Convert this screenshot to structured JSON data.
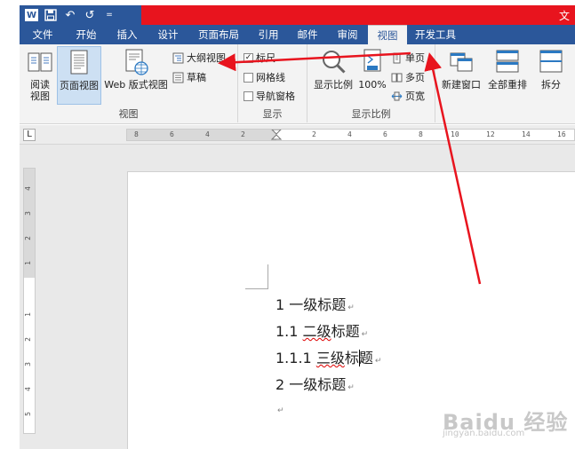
{
  "window": {
    "title_fragment": "文"
  },
  "qat": {
    "undo": "↶",
    "redo": "↺",
    "more": "="
  },
  "tabs": [
    {
      "label": "文件"
    },
    {
      "label": "开始"
    },
    {
      "label": "插入"
    },
    {
      "label": "设计"
    },
    {
      "label": "页面布局"
    },
    {
      "label": "引用"
    },
    {
      "label": "邮件"
    },
    {
      "label": "审阅"
    },
    {
      "label": "视图",
      "active": true
    },
    {
      "label": "开发工具"
    }
  ],
  "ribbon": {
    "views_group": {
      "label": "视图",
      "read_mode": "阅读\n视图",
      "print_layout": "页面视图",
      "web_layout": "Web 版式视图",
      "outline": "大纲视图",
      "draft": "草稿"
    },
    "show_group": {
      "label": "显示",
      "ruler": "标尺",
      "gridlines": "网格线",
      "nav_pane": "导航窗格",
      "ruler_checked": true
    },
    "zoom_group": {
      "label": "显示比例",
      "zoom": "显示比例",
      "hundred": "100%",
      "one_page": "单页",
      "multi_page": "多页",
      "page_width": "页宽"
    },
    "window_group": {
      "new_window": "新建窗口",
      "arrange_all": "全部重排",
      "split": "拆分"
    }
  },
  "ruler": {
    "corner": "L",
    "h_labels": [
      "8",
      "6",
      "4",
      "2",
      "2",
      "4",
      "6",
      "8",
      "10",
      "12",
      "14",
      "16"
    ],
    "v_labels": [
      "4",
      "3",
      "2",
      "1",
      "1",
      "2",
      "3",
      "4",
      "5"
    ]
  },
  "document": {
    "lines": [
      {
        "num": "1",
        "text": "一级标题",
        "squiggle": ""
      },
      {
        "num": "1.1",
        "text": "二级标题",
        "squiggle": "二级"
      },
      {
        "num": "1.1.1",
        "text": "三级标题",
        "squiggle": "三级"
      },
      {
        "num": "2",
        "text": "一级标题",
        "squiggle": ""
      }
    ],
    "paragraph_mark": "↵"
  },
  "watermark": {
    "main": "Baidu 经验",
    "sub": "jingyan.baidu.com"
  },
  "colors": {
    "word_blue": "#2b579a",
    "title_red": "#e8141e",
    "arrow_red": "#e8141e",
    "selected_button": "#cde0f3"
  }
}
